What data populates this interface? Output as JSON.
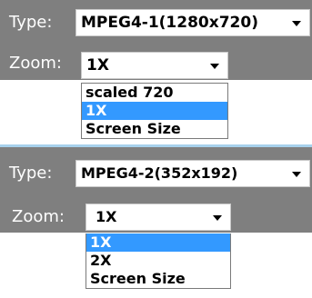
{
  "panel1": {
    "type_label": "Type:",
    "type_value": "MPEG4-1(1280x720)",
    "zoom_label": "Zoom:",
    "zoom_value": "1X",
    "zoom_options": [
      "scaled 720",
      "1X",
      "Screen Size"
    ],
    "highlighted_option": "1X"
  },
  "panel2": {
    "type_label": "Type:",
    "type_value": "MPEG4-2(352x192)",
    "zoom_label": "Zoom:",
    "zoom_value": "1X",
    "zoom_options": [
      "1X",
      "2X",
      "Screen Size"
    ],
    "highlighted_option": "1X"
  },
  "colors": {
    "panel_bg": "#7f7f7f",
    "separator": "#a7d1ec",
    "highlight": "#3399ff"
  },
  "icons": {
    "dropdown_arrow": "chevron-down-icon"
  }
}
